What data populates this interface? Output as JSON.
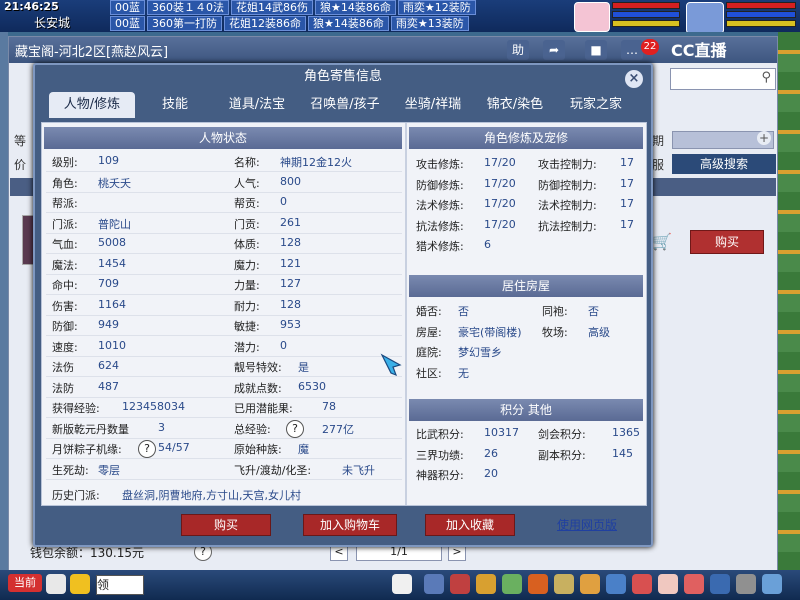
{
  "game": {
    "clock": "21:46:25",
    "city": "长安城",
    "feed_top": [
      "00蓝",
      "360装１４0法",
      "花姐14武86伤",
      "狼★14装86命",
      "雨奕★12装防"
    ],
    "feed_bottom": [
      "00蓝",
      "360第一打防",
      "花姐12装86命",
      "狼★14装86命",
      "雨奕★13装防"
    ],
    "badge_count": "22",
    "cc_brand": "CC直播"
  },
  "store": {
    "title": "藏宝阁-河北2区[燕赵风云]",
    "toolbar_icons": [
      "助",
      "share-icon",
      "stop-icon",
      "chat-icon"
    ],
    "ghost_left_1": "等",
    "ghost_left_2": "价",
    "ghost_right_1": "期",
    "ghost_right_2": "服",
    "adv_search": "高级搜索",
    "side_buy": "购买",
    "wallet_label": "钱包余额：130.15元",
    "page": "1/1",
    "prev": "<",
    "next": ">",
    "help": "?"
  },
  "dialog": {
    "title": "角色寄售信息",
    "close": "×",
    "tabs": [
      "人物/修炼",
      "技能",
      "道具/法宝",
      "召唤兽/孩子",
      "坐骑/祥瑞",
      "锦衣/染色",
      "玩家之家"
    ],
    "status_title": "人物状态",
    "status_left": [
      {
        "label": "级别:",
        "value": "109"
      },
      {
        "label": "角色:",
        "value": "桃夭夭"
      },
      {
        "label": "帮派:",
        "value": ""
      },
      {
        "label": "门派:",
        "value": "普陀山"
      },
      {
        "label": "气血:",
        "value": "5008"
      },
      {
        "label": "魔法:",
        "value": "1454"
      },
      {
        "label": "命中:",
        "value": "709"
      },
      {
        "label": "伤害:",
        "value": "1164"
      },
      {
        "label": "防御:",
        "value": "949"
      },
      {
        "label": "速度:",
        "value": "1010"
      },
      {
        "label": "法伤",
        "value": "624"
      },
      {
        "label": "法防",
        "value": "487"
      },
      {
        "label": "获得经验:",
        "value": "123458034"
      },
      {
        "label": "新版乾元丹数量",
        "value": "3"
      },
      {
        "label": "月饼粽子机缘:",
        "value": "54/57"
      },
      {
        "label": "生死劫:",
        "value": "零层"
      }
    ],
    "status_right": [
      {
        "label": "名称:",
        "value": "神期12金12火"
      },
      {
        "label": "人气:",
        "value": "800"
      },
      {
        "label": "帮贡:",
        "value": "0"
      },
      {
        "label": "门贡:",
        "value": "261"
      },
      {
        "label": "体质:",
        "value": "128"
      },
      {
        "label": "魔力:",
        "value": "121"
      },
      {
        "label": "力量:",
        "value": "127"
      },
      {
        "label": "耐力:",
        "value": "128"
      },
      {
        "label": "敏捷:",
        "value": "953"
      },
      {
        "label": "潜力:",
        "value": "0"
      },
      {
        "label": "靓号特效:",
        "value": "是"
      },
      {
        "label": "成就点数:",
        "value": "6530"
      },
      {
        "label": "已用潜能果:",
        "value": "78"
      },
      {
        "label": "总经验:",
        "value": "277亿"
      },
      {
        "label": "原始种族:",
        "value": "魔"
      },
      {
        "label": "飞升/渡劫/化圣:",
        "value": "未飞升"
      }
    ],
    "history_label": "历史门派:",
    "history_value": "盘丝洞,阴曹地府,方寸山,天宫,女儿村",
    "cult_title": "角色修炼及宠修",
    "cult_rows": [
      {
        "l1": "攻击修炼:",
        "v1": "17/20",
        "l2": "攻击控制力:",
        "v2": "17"
      },
      {
        "l1": "防御修炼:",
        "v1": "17/20",
        "l2": "防御控制力:",
        "v2": "17"
      },
      {
        "l1": "法术修炼:",
        "v1": "17/20",
        "l2": "法术控制力:",
        "v2": "17"
      },
      {
        "l1": "抗法修炼:",
        "v1": "17/20",
        "l2": "抗法控制力:",
        "v2": "17"
      },
      {
        "l1": "猎术修炼:",
        "v1": "6",
        "l2": "",
        "v2": ""
      }
    ],
    "house_title": "居住房屋",
    "house_rows": [
      {
        "l1": "婚否:",
        "v1": "否",
        "l2": "同袍:",
        "v2": "否"
      },
      {
        "l1": "房屋:",
        "v1": "豪宅(带阁楼)",
        "l2": "牧场:",
        "v2": "高级"
      },
      {
        "l1": "庭院:",
        "v1": "梦幻雪乡",
        "l2": "",
        "v2": ""
      },
      {
        "l1": "社区:",
        "v1": "无",
        "l2": "",
        "v2": ""
      }
    ],
    "score_title": "积分 其他",
    "score_rows": [
      {
        "l1": "比武积分:",
        "v1": "10317",
        "l2": "剑会积分:",
        "v2": "1365"
      },
      {
        "l1": "三界功绩:",
        "v1": "26",
        "l2": "副本积分:",
        "v2": "145"
      },
      {
        "l1": "神器积分:",
        "v1": "20",
        "l2": "",
        "v2": ""
      }
    ],
    "buttons": {
      "buy": "购买",
      "add_cart": "加入购物车",
      "add_fav": "加入收藏",
      "web": "使用网页版"
    }
  },
  "bottom": {
    "channel": "当前",
    "chat_text": "领"
  },
  "colors": {
    "accent_red": "#a82828",
    "dialog_bg": "#445d83",
    "value_blue": "#2a4a8a"
  }
}
